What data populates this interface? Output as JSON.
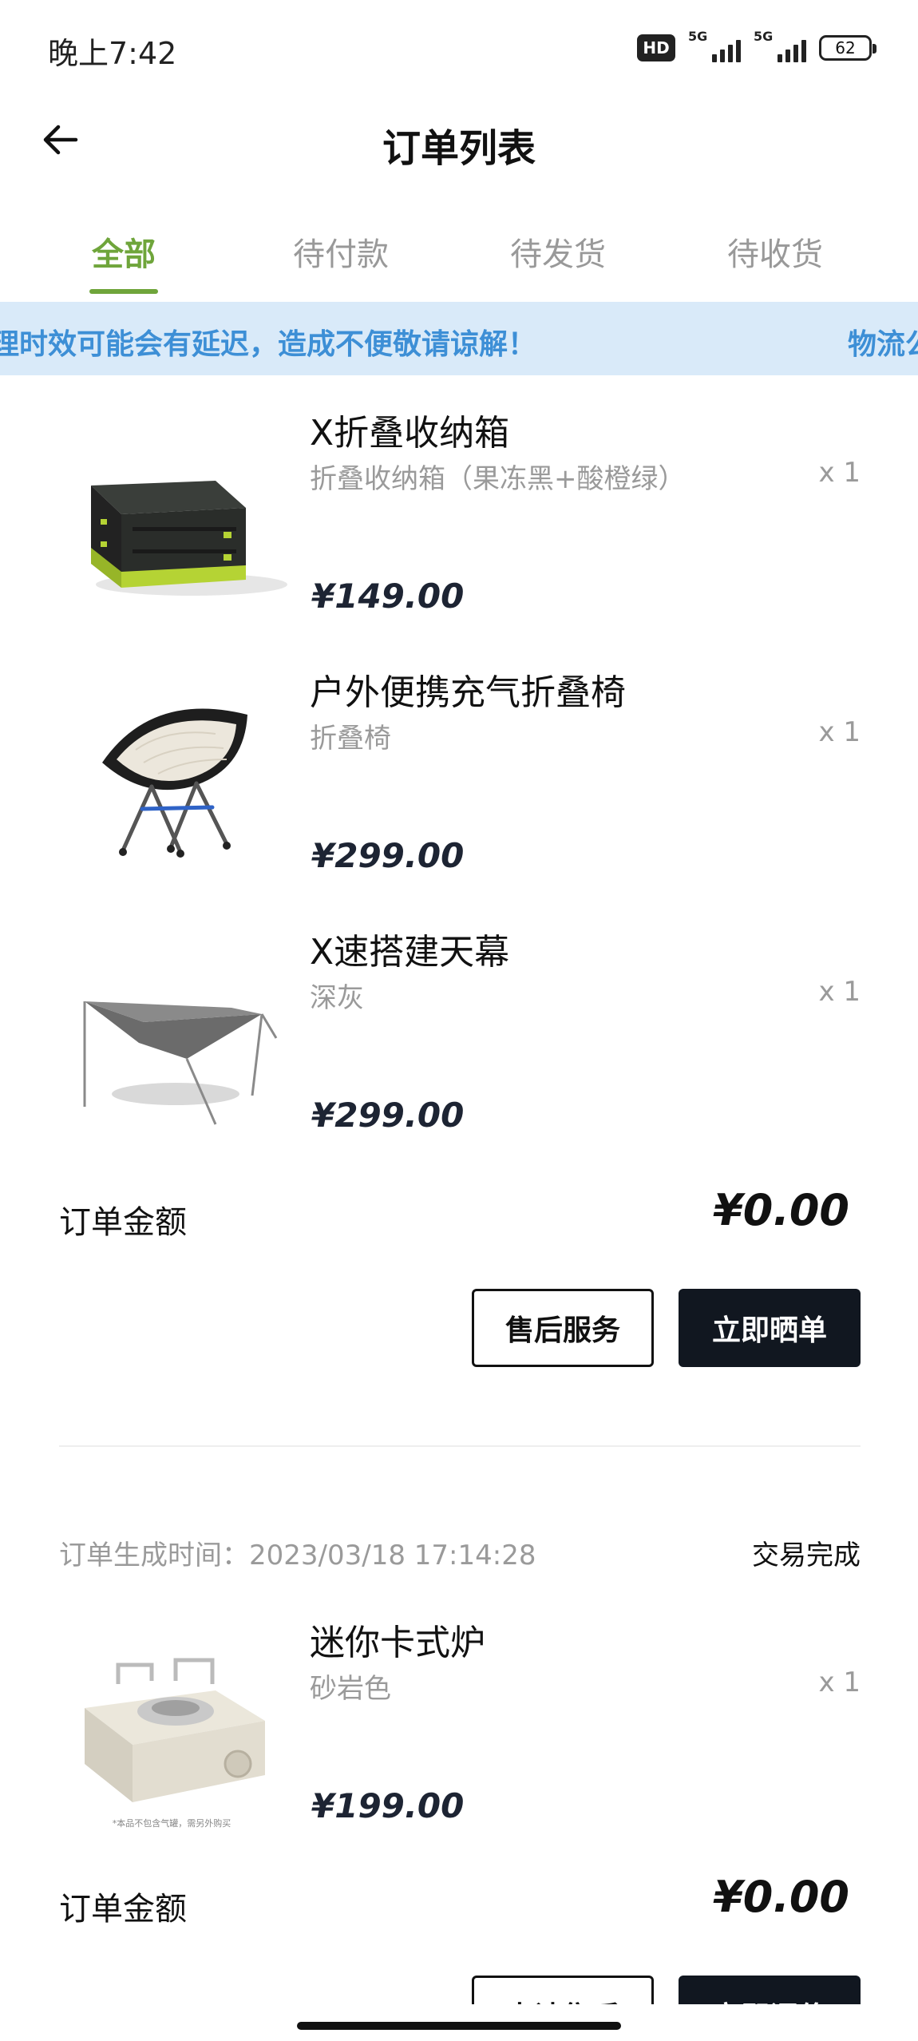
{
  "status_bar": {
    "time": "晚上7:42",
    "hd_badge": "HD",
    "signal1": "5G",
    "signal2": "5G",
    "battery": "62"
  },
  "header": {
    "title": "订单列表",
    "back_icon": "back-arrow-icon"
  },
  "tabs": [
    {
      "label": "全部",
      "active": true
    },
    {
      "label": "待付款",
      "active": false
    },
    {
      "label": "待发货",
      "active": false
    },
    {
      "label": "待收货",
      "active": false
    }
  ],
  "notice": {
    "text": "理时效可能会有延迟，造成不便敬请谅解！",
    "text_next": "物流公"
  },
  "order1": {
    "items": [
      {
        "name": "X折叠收纳箱",
        "spec": "折叠收纳箱（果冻黑+酸橙绿）",
        "qty": "x 1",
        "price": "¥149.00",
        "thumb_icon": "storage-box-icon"
      },
      {
        "name": "户外便携充气折叠椅",
        "spec": "折叠椅",
        "qty": "x 1",
        "price": "¥299.00",
        "thumb_icon": "folding-chair-icon"
      },
      {
        "name": "X速搭建天幕",
        "spec": "深灰",
        "qty": "x 1",
        "price": "¥299.00",
        "thumb_icon": "tarp-icon"
      }
    ],
    "amount_label": "订单金额",
    "amount_value": "¥0.00",
    "after_sale_label": "售后服务",
    "review_label": "立即晒单"
  },
  "order2": {
    "created_label": "订单生成时间：2023/03/18 17:14:28",
    "status": "交易完成",
    "items": [
      {
        "name": "迷你卡式炉",
        "spec": "砂岩色",
        "qty": "x 1",
        "price": "¥199.00",
        "thumb_icon": "mini-stove-icon",
        "thumb_caption": "*本品不包含气罐，需另外购买"
      }
    ],
    "amount_label": "订单金额",
    "amount_value": "¥0.00",
    "after_sale_label": "申请售后",
    "review_label": "立即评价"
  },
  "colors": {
    "accent_green": "#6fa53b",
    "notice_bg": "#d9eaf9",
    "notice_text": "#3d8fd6",
    "button_dark": "#111720"
  }
}
